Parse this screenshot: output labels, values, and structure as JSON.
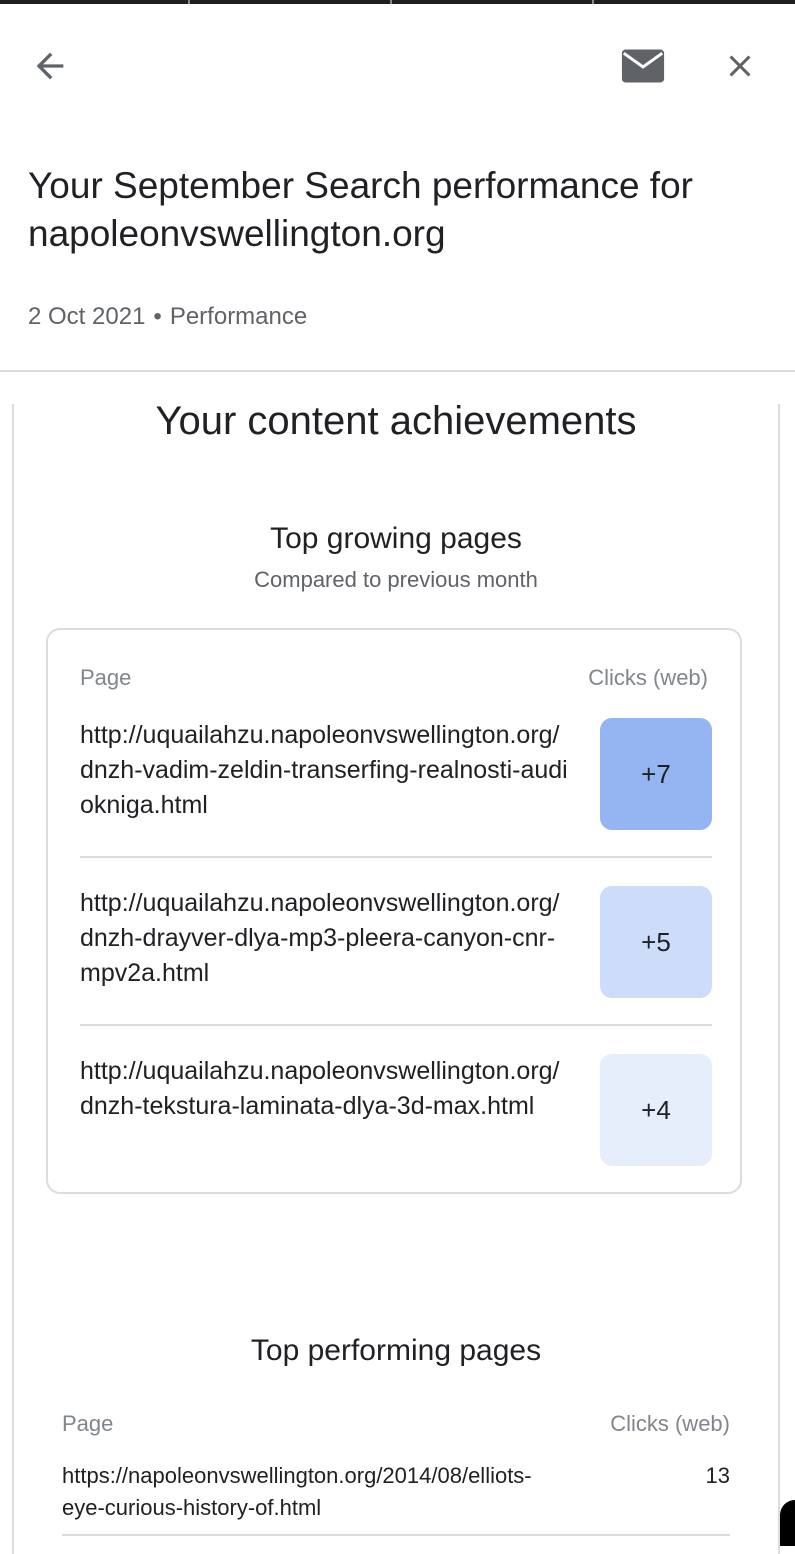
{
  "header": {
    "back_icon": "arrow-left-icon",
    "mail_icon": "mail-icon",
    "close_icon": "close-icon",
    "title": "Your September Search performance for napoleonvswellington.org",
    "date": "2 Oct 2021",
    "separator": "•",
    "category": "Performance"
  },
  "content": {
    "heading": "Your content achievements",
    "growing": {
      "title": "Top growing pages",
      "subtitle": "Compared to previous month",
      "col_page": "Page",
      "col_clicks": "Clicks (web)",
      "rows": [
        {
          "url": "http://uquailahzu.napoleonvswellington.org/dnzh-vadim-zeldin-transerfing-realnosti-audiokniga.html",
          "change": "+7",
          "color": "#94b4f2"
        },
        {
          "url": "http://uquailahzu.napoleonvswellington.org/dnzh-drayver-dlya-mp3-pleera-canyon-cnr-mpv2a.html",
          "change": "+5",
          "color": "#cddcf9"
        },
        {
          "url": "http://uquailahzu.napoleonvswellington.org/dnzh-tekstura-laminata-dlya-3d-max.html",
          "change": "+4",
          "color": "#e6eefc"
        }
      ]
    },
    "performing": {
      "title": "Top performing pages",
      "col_page": "Page",
      "col_clicks": "Clicks (web)",
      "rows": [
        {
          "url": "https://napoleonvswellington.org/2014/08/elliots-eye-curious-history-of.html",
          "clicks": "13"
        }
      ]
    }
  },
  "colors": {
    "text": "#202124",
    "muted": "#5f6368",
    "divider": "#dadce0"
  }
}
